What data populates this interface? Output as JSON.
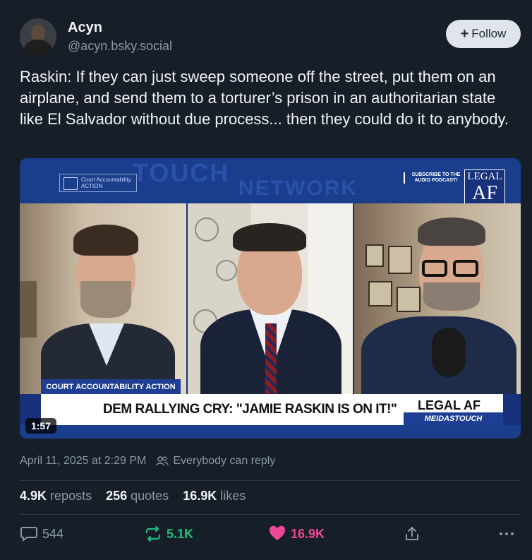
{
  "author": {
    "display_name": "Acyn",
    "handle": "@acyn.bsky.social"
  },
  "follow_button": {
    "icon": "plus-icon",
    "label": "Follow"
  },
  "post": {
    "text": "Raskin: If they can just sweep someone off the street, put them on an airplane, and send them to a torturer’s prison in an authoritarian state like El Salvador without due process... then they could do it to anybody."
  },
  "video": {
    "duration": "1:57",
    "overlay": {
      "bg_word_1": "TOUCH",
      "bg_word_2": "NETWORK",
      "cca_logo": "Court Accountability ACTION",
      "subscribe": "SUBSCRIBE TO THE AUDIO PODCAST!",
      "legal_logo_line1": "LEGAL",
      "legal_logo_line2": "AF",
      "lower_label": "COURT ACCOUNTABILITY ACTION",
      "headline": "DEM RALLYING CRY: \"JAMIE RASKIN IS ON IT!\"",
      "brand_title": "LEGAL AF",
      "brand_sub": "MEIDASTOUCH"
    }
  },
  "meta": {
    "timestamp": "April 11, 2025 at 2:29 PM",
    "reply_setting": "Everybody can reply",
    "reply_icon": "people-icon"
  },
  "stats": {
    "reposts_value": "4.9K",
    "reposts_label": "reposts",
    "quotes_value": "256",
    "quotes_label": "quotes",
    "likes_value": "16.9K",
    "likes_label": "likes"
  },
  "actions": {
    "reply_count": "544",
    "repost_count": "5.1K",
    "like_count": "16.9K",
    "colors": {
      "reply": "#8b98a5",
      "repost": "#20bc7c",
      "like": "#ec4899"
    }
  }
}
